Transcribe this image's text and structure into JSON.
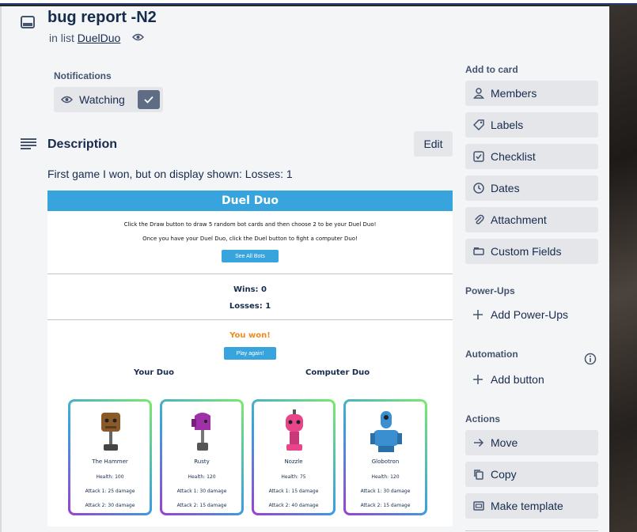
{
  "card": {
    "title": "bug report -N2",
    "in_list_prefix": "in list",
    "list_name": "DuelDuo"
  },
  "notifications": {
    "heading": "Notifications",
    "watch_label": "Watching"
  },
  "description": {
    "heading": "Description",
    "edit_label": "Edit",
    "text": "First game I won, but on display shown: Losses: 1"
  },
  "embed": {
    "title": "Duel Duo",
    "instruction1": "Click the Draw button to draw 5 random bot cards and then choose 2 to be your Duel Duo!",
    "instruction2": "Once you have your Duel Duo, click the Duel button to fight a computer Duo!",
    "see_all_label": "See All Bots",
    "wins": "Wins: 0",
    "losses": "Losses: 1",
    "result": "You won!",
    "play_again_label": "Play again!",
    "your_duo_label": "Your Duo",
    "computer_duo_label": "Computer Duo",
    "bots": [
      {
        "name": "The Hammer",
        "health": "Health: 100",
        "attack1": "Attack 1: 25 damage",
        "attack2": "Attack 2: 30 damage",
        "color": "#8b5a2b"
      },
      {
        "name": "Rusty",
        "health": "Health: 120",
        "attack1": "Attack 1: 30 damage",
        "attack2": "Attack 2: 15 damage",
        "color": "#a030a8"
      },
      {
        "name": "Nozzle",
        "health": "Health: 75",
        "attack1": "Attack 1: 15 damage",
        "attack2": "Attack 2: 40 damage",
        "color": "#e8458a"
      },
      {
        "name": "Globotron",
        "health": "Health: 120",
        "attack1": "Attack 1: 30 damage",
        "attack2": "Attack 2: 15 damage",
        "color": "#3a8fd0"
      }
    ]
  },
  "sidebar": {
    "add_to_card_heading": "Add to card",
    "add_to_card": [
      {
        "label": "Members",
        "icon": "person-icon"
      },
      {
        "label": "Labels",
        "icon": "tag-icon"
      },
      {
        "label": "Checklist",
        "icon": "checkbox-icon"
      },
      {
        "label": "Dates",
        "icon": "clock-icon"
      },
      {
        "label": "Attachment",
        "icon": "paperclip-icon"
      },
      {
        "label": "Custom Fields",
        "icon": "fields-icon"
      }
    ],
    "powerups_heading": "Power-Ups",
    "add_powerups_label": "Add Power-Ups",
    "automation_heading": "Automation",
    "add_button_label": "Add button",
    "actions_heading": "Actions",
    "actions": [
      {
        "label": "Move",
        "icon": "arrow-right-icon"
      },
      {
        "label": "Copy",
        "icon": "copy-icon"
      },
      {
        "label": "Make template",
        "icon": "template-icon"
      }
    ]
  },
  "colors": {
    "accent_blue": "#38a4dd",
    "win_orange": "#f08c1e",
    "button_gray": "#e4e6ea",
    "text_dark": "#172b4d"
  }
}
